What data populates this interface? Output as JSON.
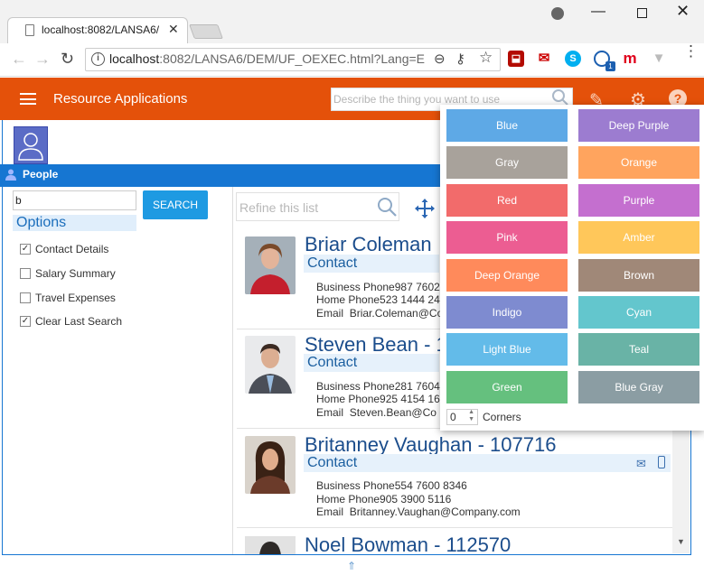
{
  "browser": {
    "tab_title": "localhost:8082/LANSA6/",
    "url_host": "localhost",
    "url_path": ":8082/LANSA6/DEM/UF_OEXEC.html?Lang=E...",
    "ext_badge": "1"
  },
  "app": {
    "title": "Resource Applications",
    "search_placeholder": "Describe the thing you want to use",
    "accent": "#e4510a"
  },
  "people": {
    "label": "People"
  },
  "left": {
    "search_value": "b",
    "search_button": "SEARCH",
    "options_title": "Options",
    "options": [
      {
        "label": "Contact Details",
        "checked": true
      },
      {
        "label": "Salary Summary",
        "checked": false
      },
      {
        "label": "Travel Expenses",
        "checked": false
      },
      {
        "label": "Clear Last Search",
        "checked": true
      }
    ]
  },
  "list": {
    "refine_placeholder": "Refine this list",
    "contact_label": "Contact",
    "labels": {
      "business": "Business Phone",
      "home": "Home Phone",
      "email": "Email"
    },
    "cards": [
      {
        "name": "Briar Coleman",
        "business": "987 7602",
        "home": "523 1444 24",
        "email": "Briar.Coleman@Co"
      },
      {
        "name": "Steven Bean - 1",
        "business": "281 7604",
        "home": "925 4154 16",
        "email": "Steven.Bean@Co"
      },
      {
        "name": "Britanney Vaughan - 107716",
        "business": "554 7600 8346",
        "home": "905 3900 5116",
        "email": "Britanney.Vaughan@Company.com"
      },
      {
        "name": "Noel Bowman - 112570",
        "business": "",
        "home": "",
        "email": ""
      }
    ]
  },
  "palette": {
    "swatches": [
      {
        "label": "Blue",
        "color": "#5ea9e6"
      },
      {
        "label": "Deep Purple",
        "color": "#9c7cd0"
      },
      {
        "label": "Gray",
        "color": "#a8a29b"
      },
      {
        "label": "Orange",
        "color": "#ffa45e"
      },
      {
        "label": "Red",
        "color": "#f26b6b"
      },
      {
        "label": "Purple",
        "color": "#c46fcf"
      },
      {
        "label": "Pink",
        "color": "#ec5d92"
      },
      {
        "label": "Amber",
        "color": "#ffc75a"
      },
      {
        "label": "Deep Orange",
        "color": "#ff8a5b"
      },
      {
        "label": "Brown",
        "color": "#a08878"
      },
      {
        "label": "Indigo",
        "color": "#7e8bd0"
      },
      {
        "label": "Cyan",
        "color": "#63c6cd"
      },
      {
        "label": "Light Blue",
        "color": "#63bbe9"
      },
      {
        "label": "Teal",
        "color": "#69b3a6"
      },
      {
        "label": "Green",
        "color": "#65c07e"
      },
      {
        "label": "Blue Gray",
        "color": "#8b9da3"
      }
    ],
    "corners_value": "0",
    "corners_label": "Corners"
  }
}
